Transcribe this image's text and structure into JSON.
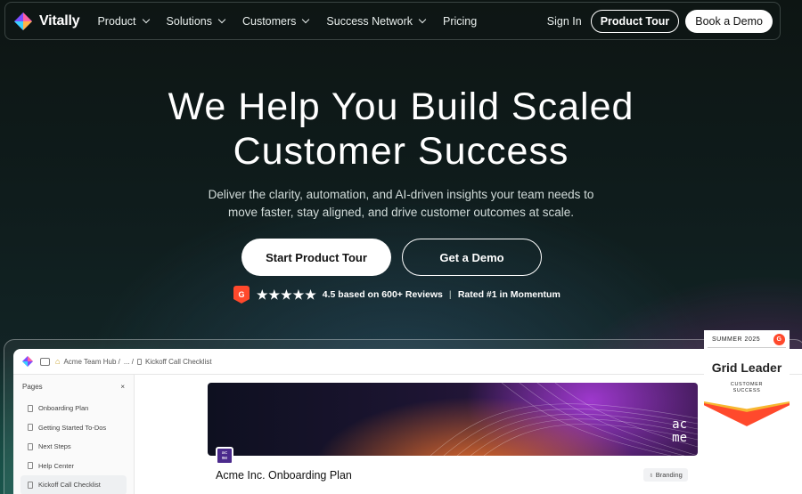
{
  "nav": {
    "brand": "Vitally",
    "items": [
      {
        "label": "Product",
        "has_dropdown": true
      },
      {
        "label": "Solutions",
        "has_dropdown": true
      },
      {
        "label": "Customers",
        "has_dropdown": true
      },
      {
        "label": "Success Network",
        "has_dropdown": true
      },
      {
        "label": "Pricing",
        "has_dropdown": false
      }
    ],
    "sign_in": "Sign In",
    "product_tour": "Product Tour",
    "book_demo": "Book a Demo"
  },
  "hero": {
    "title_line1": "We Help You Build Scaled",
    "title_line2": "Customer Success",
    "subtitle_line1": "Deliver the clarity, automation, and AI-driven insights your team needs to",
    "subtitle_line2": "move faster, stay aligned, and drive customer outcomes at scale.",
    "cta_primary": "Start Product Tour",
    "cta_secondary": "Get a Demo"
  },
  "rating": {
    "badge": "G",
    "stars": "★★★★★",
    "stars_value": 4.5,
    "reviews_text": "4.5 based on 600+ Reviews",
    "rank_text": "Rated #1 in Momentum"
  },
  "app_preview": {
    "breadcrumb_hub": "Acme Team Hub /",
    "breadcrumb_ellipsis": "... /",
    "breadcrumb_page": "Kickoff Call Checklist",
    "sidebar_title": "Pages",
    "sidebar_close": "×",
    "pages": [
      {
        "label": "Onboarding Plan",
        "active": false
      },
      {
        "label": "Getting Started To-Dos",
        "active": false
      },
      {
        "label": "Next Steps",
        "active": false
      },
      {
        "label": "Help Center",
        "active": false
      },
      {
        "label": "Kickoff Call Checklist",
        "active": true
      }
    ],
    "banner_logo_line1": "ac",
    "banner_logo_line2": "me",
    "page_title": "Acme Inc. Onboarding Plan",
    "tag": "Branding"
  },
  "award": {
    "season": "SUMMER 2025",
    "g2": "G",
    "title": "Grid Leader",
    "category_line1": "CUSTOMER",
    "category_line2": "SUCCESS"
  },
  "colors": {
    "g2_red": "#ff492c",
    "award_yellow": "#f7b731",
    "acme_purple": "#4b2a8c"
  }
}
